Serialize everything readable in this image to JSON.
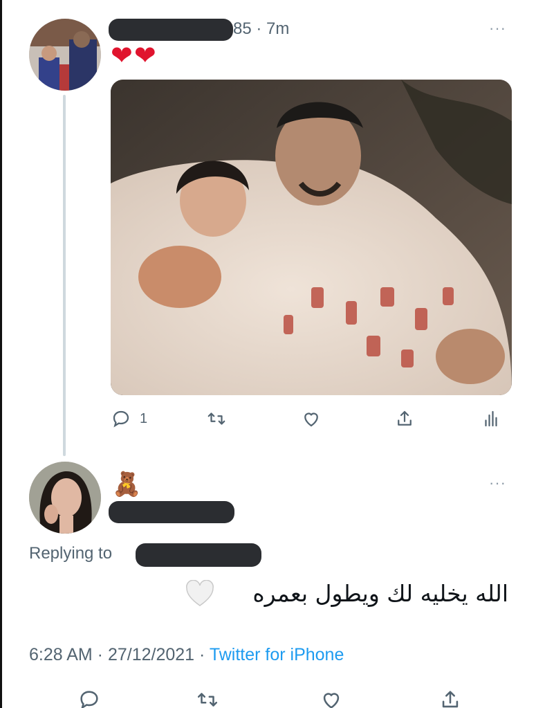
{
  "tweet": {
    "handle_suffix": "85",
    "separator": "·",
    "time": "7m",
    "text_emoji": "♥♥",
    "more": "···",
    "actions": {
      "reply_count": "1"
    }
  },
  "reply": {
    "name_emoji": "🧸",
    "more": "···",
    "replying_label": "Replying to",
    "text": "الله يخليه لك ويطول بعمره",
    "timestamp": "6:28 AM · 27/12/2021 · ",
    "source": "Twitter for iPhone"
  },
  "colors": {
    "accent": "#1d9bf0",
    "muted": "#536471",
    "heart": "#e0142e",
    "redaction": "#2b2d31"
  },
  "icons": [
    "reply-icon",
    "retweet-icon",
    "like-icon",
    "share-icon",
    "analytics-icon"
  ]
}
